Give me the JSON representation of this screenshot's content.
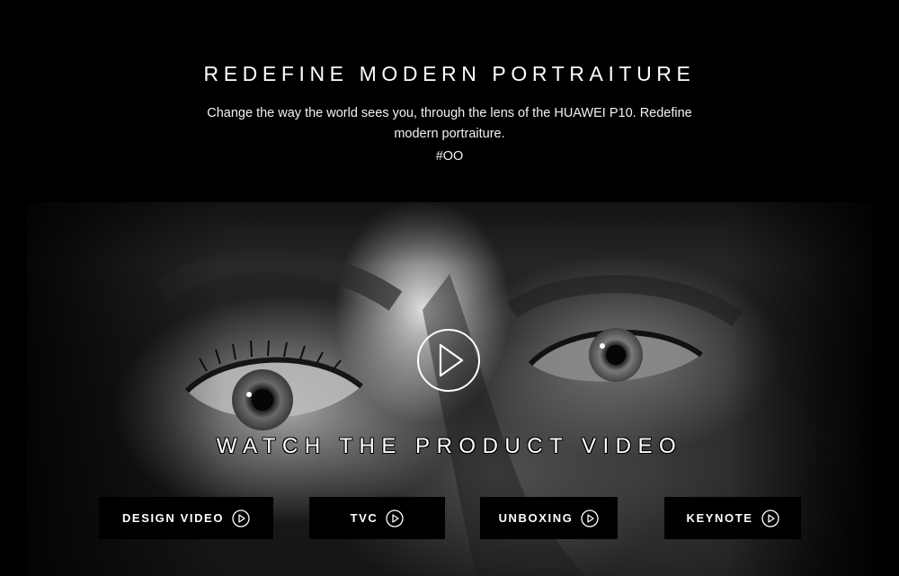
{
  "intro": {
    "title": "REDEFINE MODERN PORTRAITURE",
    "description": "Change the way the world sees you, through the lens of the HUAWEI P10. Redefine modern portraiture.",
    "hashtag": "#OO"
  },
  "hero": {
    "play_icon": "play-circle-icon",
    "watch_title": "WATCH THE PRODUCT VIDEO"
  },
  "video_buttons": [
    {
      "label": "DESIGN VIDEO",
      "icon": "play-circle-icon"
    },
    {
      "label": "TVC",
      "icon": "play-circle-icon"
    },
    {
      "label": "UNBOXING",
      "icon": "play-circle-icon"
    },
    {
      "label": "KEYNOTE",
      "icon": "play-circle-icon"
    }
  ],
  "colors": {
    "background": "#000000",
    "text": "#ffffff",
    "button_bg": "#000000"
  }
}
